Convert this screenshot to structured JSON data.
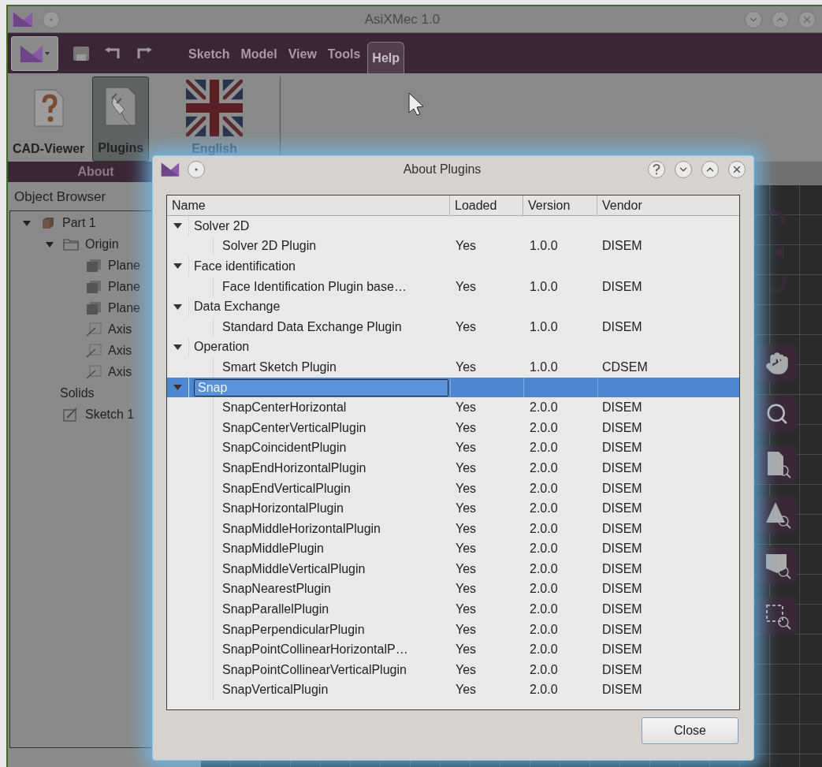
{
  "app": {
    "title": "AsiXMec 1.0",
    "menu_tabs": [
      {
        "label": "Sketch",
        "selected": false
      },
      {
        "label": "Model",
        "selected": false
      },
      {
        "label": "View",
        "selected": false
      },
      {
        "label": "Tools",
        "selected": false
      },
      {
        "label": "Help",
        "selected": true
      }
    ],
    "ribbon": {
      "buttons": [
        {
          "label": "CAD-Viewer",
          "kind": "help",
          "selected": false
        },
        {
          "label": "Plugins",
          "kind": "plugin",
          "selected": true
        },
        {
          "label": "English",
          "kind": "flag",
          "selected": false
        }
      ],
      "group_label": "About"
    },
    "object_browser": {
      "title": "Object Browser",
      "tree": [
        {
          "label": "Part 1",
          "kind": "part",
          "expanded": true,
          "children": [
            {
              "label": "Origin",
              "kind": "folder",
              "expanded": true,
              "children": [
                {
                  "label": "Plane",
                  "kind": "plane"
                },
                {
                  "label": "Plane",
                  "kind": "plane"
                },
                {
                  "label": "Plane",
                  "kind": "plane"
                },
                {
                  "label": "Axis",
                  "kind": "axis"
                },
                {
                  "label": "Axis",
                  "kind": "axis"
                },
                {
                  "label": "Axis",
                  "kind": "axis"
                }
              ]
            },
            {
              "label": "Solids",
              "kind": "group"
            },
            {
              "label": "Sketch 1",
              "kind": "sketch"
            }
          ]
        }
      ]
    }
  },
  "dialog": {
    "title": "About Plugins",
    "columns": [
      "Name",
      "Loaded",
      "Version",
      "Vendor"
    ],
    "groups": [
      {
        "name": "Solver 2D",
        "expanded": true,
        "selected": false,
        "children": [
          {
            "name": "Solver 2D Plugin",
            "loaded": "Yes",
            "version": "1.0.0",
            "vendor": "DISEM"
          }
        ]
      },
      {
        "name": "Face identification",
        "expanded": true,
        "selected": false,
        "children": [
          {
            "name": "Face Identification Plugin base…",
            "loaded": "Yes",
            "version": "1.0.0",
            "vendor": "DISEM"
          }
        ]
      },
      {
        "name": "Data Exchange",
        "expanded": true,
        "selected": false,
        "children": [
          {
            "name": "Standard Data Exchange Plugin",
            "loaded": "Yes",
            "version": "1.0.0",
            "vendor": "DISEM"
          }
        ]
      },
      {
        "name": "Operation",
        "expanded": true,
        "selected": false,
        "children": [
          {
            "name": "Smart Sketch Plugin",
            "loaded": "Yes",
            "version": "1.0.0",
            "vendor": "CDSEM"
          }
        ]
      },
      {
        "name": "Snap",
        "expanded": true,
        "selected": true,
        "children": [
          {
            "name": "SnapCenterHorizontal",
            "loaded": "Yes",
            "version": "2.0.0",
            "vendor": "DISEM"
          },
          {
            "name": "SnapCenterVerticalPlugin",
            "loaded": "Yes",
            "version": "2.0.0",
            "vendor": "DISEM"
          },
          {
            "name": "SnapCoincidentPlugin",
            "loaded": "Yes",
            "version": "2.0.0",
            "vendor": "DISEM"
          },
          {
            "name": "SnapEndHorizontalPlugin",
            "loaded": "Yes",
            "version": "2.0.0",
            "vendor": "DISEM"
          },
          {
            "name": "SnapEndVerticalPlugin",
            "loaded": "Yes",
            "version": "2.0.0",
            "vendor": "DISEM"
          },
          {
            "name": "SnapHorizontalPlugin",
            "loaded": "Yes",
            "version": "2.0.0",
            "vendor": "DISEM"
          },
          {
            "name": "SnapMiddleHorizontalPlugin",
            "loaded": "Yes",
            "version": "2.0.0",
            "vendor": "DISEM"
          },
          {
            "name": "SnapMiddlePlugin",
            "loaded": "Yes",
            "version": "2.0.0",
            "vendor": "DISEM"
          },
          {
            "name": "SnapMiddleVerticalPlugin",
            "loaded": "Yes",
            "version": "2.0.0",
            "vendor": "DISEM"
          },
          {
            "name": "SnapNearestPlugin",
            "loaded": "Yes",
            "version": "2.0.0",
            "vendor": "DISEM"
          },
          {
            "name": "SnapParallelPlugin",
            "loaded": "Yes",
            "version": "2.0.0",
            "vendor": "DISEM"
          },
          {
            "name": "SnapPerpendicularPlugin",
            "loaded": "Yes",
            "version": "2.0.0",
            "vendor": "DISEM"
          },
          {
            "name": "SnapPointCollinearHorizontalP…",
            "loaded": "Yes",
            "version": "2.0.0",
            "vendor": "DISEM"
          },
          {
            "name": "SnapPointCollinearVerticalPlugin",
            "loaded": "Yes",
            "version": "2.0.0",
            "vendor": "DISEM"
          },
          {
            "name": "SnapVerticalPlugin",
            "loaded": "Yes",
            "version": "2.0.0",
            "vendor": "DISEM"
          }
        ]
      }
    ],
    "close_button": "Close"
  }
}
